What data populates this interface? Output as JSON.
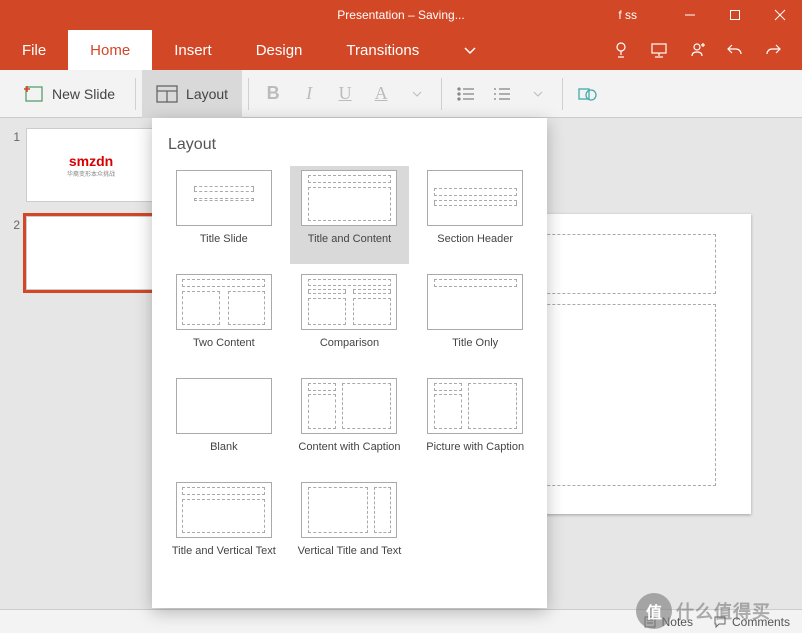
{
  "titlebar": {
    "title": "Presentation – Saving...",
    "user": "f ss"
  },
  "tabs": {
    "file": "File",
    "home": "Home",
    "insert": "Insert",
    "design": "Design",
    "transitions": "Transitions"
  },
  "ribbon": {
    "newslide": "New Slide",
    "layout": "Layout"
  },
  "layout_popup": {
    "header": "Layout",
    "items": [
      {
        "label": "Title Slide",
        "selected": false
      },
      {
        "label": "Title and Content",
        "selected": true
      },
      {
        "label": "Section Header",
        "selected": false
      },
      {
        "label": "Two Content",
        "selected": false
      },
      {
        "label": "Comparison",
        "selected": false
      },
      {
        "label": "Title Only",
        "selected": false
      },
      {
        "label": "Blank",
        "selected": false
      },
      {
        "label": "Content with Caption",
        "selected": false
      },
      {
        "label": "Picture with Caption",
        "selected": false
      },
      {
        "label": "Title and Vertical Text",
        "selected": false
      },
      {
        "label": "Vertical Title and Text",
        "selected": false
      }
    ]
  },
  "slides": {
    "items": [
      {
        "num": "1",
        "logo": "smzdn",
        "sub": "华裔变形本众挑战",
        "selected": false
      },
      {
        "num": "2",
        "logo": "",
        "sub": "",
        "selected": true
      }
    ]
  },
  "statusbar": {
    "notes": "Notes",
    "comments": "Comments"
  },
  "watermark": {
    "text": "什么值得买"
  }
}
